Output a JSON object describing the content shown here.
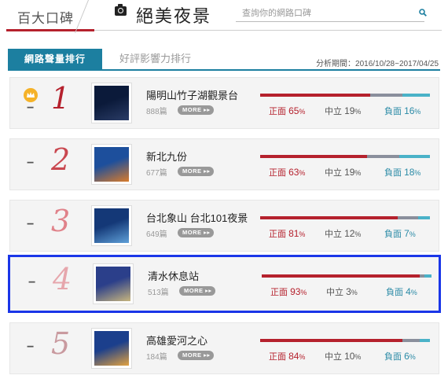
{
  "header": {
    "brand": "百大口碑",
    "title": "絕美夜景",
    "search_placeholder": "查詢你的網路口碑"
  },
  "tabs": [
    {
      "label": "網路聲量排行",
      "active": true
    },
    {
      "label": "好評影響力排行",
      "active": false
    }
  ],
  "period": "分析期間：2016/10/28~2017/04/25",
  "labels": {
    "positive": "正面",
    "neutral": "中立",
    "negative": "負面",
    "more": "MORE",
    "dash": "−",
    "percent": "%"
  },
  "colors": {
    "accent": "#1c7fa0",
    "positive": "#b5212d",
    "neutral": "#8a8f9c",
    "negative": "#4ab2c8",
    "highlight_border": "#1a36e8",
    "crown": "#f5b228"
  },
  "rankings": [
    {
      "rank": "1",
      "name": "陽明山竹子湖觀景台",
      "count": "888篇",
      "positive": 65,
      "neutral": 19,
      "negative": 16,
      "rank_color": "#b5212d",
      "crown": true,
      "thumb": [
        "#0b1a3a",
        "#2a3c66"
      ]
    },
    {
      "rank": "2",
      "name": "新北九份",
      "count": "677篇",
      "positive": 63,
      "neutral": 19,
      "negative": 18,
      "rank_color": "#c9474f",
      "crown": false,
      "thumb": [
        "#1d4f9c",
        "#d97b2b"
      ]
    },
    {
      "rank": "3",
      "name": "台北象山 台北101夜景",
      "count": "649篇",
      "positive": 81,
      "neutral": 12,
      "negative": 7,
      "rank_color": "#e0828a",
      "crown": false,
      "thumb": [
        "#143877",
        "#5fa0d8"
      ]
    },
    {
      "rank": "4",
      "name": "清水休息站",
      "count": "513篇",
      "positive": 93,
      "neutral": 3,
      "negative": 4,
      "rank_color": "#e6a6ac",
      "crown": false,
      "highlight": true,
      "thumb": [
        "#2b3f8a",
        "#c7b57e"
      ]
    },
    {
      "rank": "5",
      "name": "高雄愛河之心",
      "count": "184篇",
      "positive": 84,
      "neutral": 10,
      "negative": 6,
      "rank_color": "#c99a9f",
      "crown": false,
      "thumb": [
        "#1b3f8c",
        "#e2a240"
      ]
    }
  ]
}
